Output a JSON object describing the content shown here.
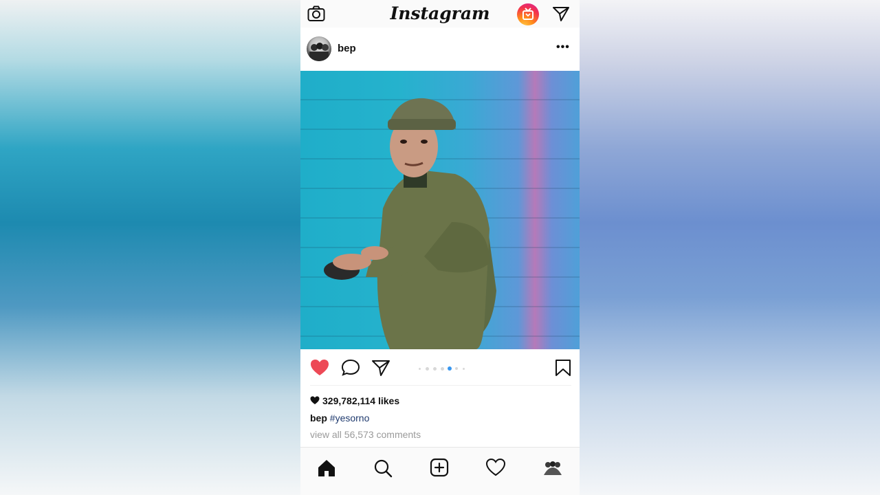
{
  "app": {
    "title": "Instagram"
  },
  "header": {
    "icons": [
      "camera-icon",
      "igtv-icon",
      "direct-message-icon"
    ]
  },
  "post": {
    "username": "bep",
    "more_label": "•••",
    "carousel": {
      "count": 7,
      "active_index": 4
    },
    "likes_text": "329,782,114 likes",
    "caption_user": "bep",
    "caption_tag": "#yesorno",
    "comments_text": "view all 56,573 comments",
    "liked": true
  },
  "nav": {
    "items": [
      "home-icon",
      "search-icon",
      "new-post-icon",
      "activity-heart-icon",
      "profile-avatar"
    ]
  },
  "colors": {
    "like_red": "#ed4956",
    "active_dot": "#3897f0",
    "hashtag": "#1f3a6e"
  }
}
